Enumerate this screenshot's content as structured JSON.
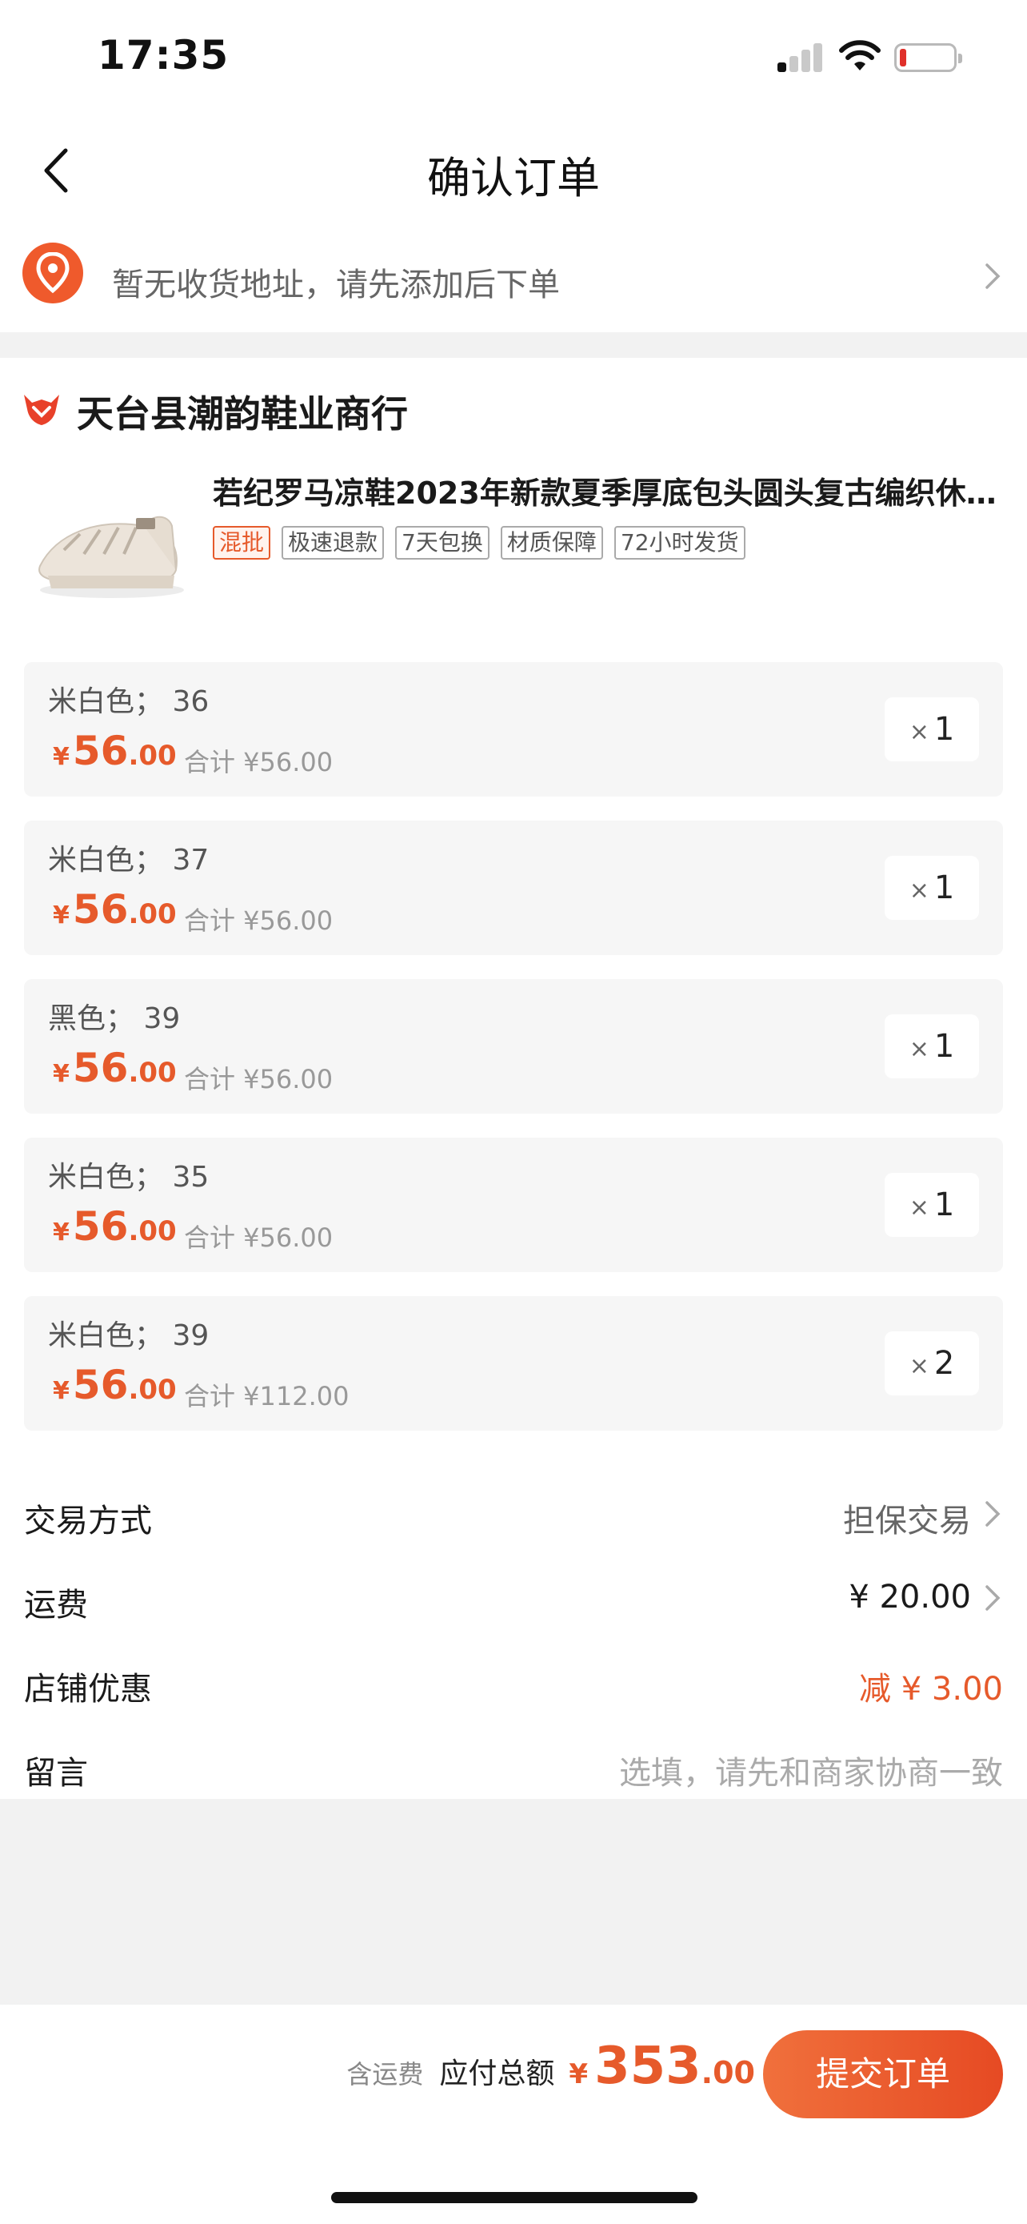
{
  "status": {
    "time": "17:35",
    "colors": {
      "battery_low": "#e0302a"
    }
  },
  "nav": {
    "title": "确认订单"
  },
  "address": {
    "placeholder": "暂无收货地址，请先添加后下单"
  },
  "store": {
    "name": "天台县潮韵鞋业商行",
    "product": {
      "title": "若纪罗马凉鞋2023年新款夏季厚底包头圆头复古编织休闲鞋",
      "tags": [
        "混批",
        "极速退款",
        "7天包换",
        "材质保障",
        "72小时发货"
      ]
    },
    "variants": [
      {
        "spec": "米白色； 36",
        "currency": "¥",
        "price_int": "56",
        "price_dec": ".00",
        "subtotal": "合计 ¥56.00",
        "qty_symbol": "×",
        "qty": "1"
      },
      {
        "spec": "米白色； 37",
        "currency": "¥",
        "price_int": "56",
        "price_dec": ".00",
        "subtotal": "合计 ¥56.00",
        "qty_symbol": "×",
        "qty": "1"
      },
      {
        "spec": "黑色； 39",
        "currency": "¥",
        "price_int": "56",
        "price_dec": ".00",
        "subtotal": "合计 ¥56.00",
        "qty_symbol": "×",
        "qty": "1"
      },
      {
        "spec": "米白色； 35",
        "currency": "¥",
        "price_int": "56",
        "price_dec": ".00",
        "subtotal": "合计 ¥56.00",
        "qty_symbol": "×",
        "qty": "1"
      },
      {
        "spec": "米白色； 39",
        "currency": "¥",
        "price_int": "56",
        "price_dec": ".00",
        "subtotal": "合计 ¥112.00",
        "qty_symbol": "×",
        "qty": "2"
      }
    ]
  },
  "order_info": {
    "trade_method": {
      "label": "交易方式",
      "value": "担保交易"
    },
    "shipping": {
      "label": "运费",
      "value": "¥ 20.00"
    },
    "shop_discount": {
      "label": "店铺优惠",
      "value": "减 ¥ 3.00"
    },
    "message": {
      "label": "留言",
      "placeholder": "选填，请先和商家协商一致"
    }
  },
  "bottom": {
    "includes_shipping": "含运费",
    "total_label": "应付总额",
    "total_currency": "¥",
    "total_int": "353",
    "total_dec": ".00",
    "submit_label": "提交订单"
  },
  "colors": {
    "accent": "#e65a2b",
    "button_gradient_start": "#f0703c",
    "button_gradient_end": "#e64a23"
  },
  "icons": [
    "back-icon",
    "location-pin-icon",
    "chevron-right-icon",
    "shop-logo-icon",
    "signal-icon",
    "wifi-icon",
    "battery-icon"
  ]
}
